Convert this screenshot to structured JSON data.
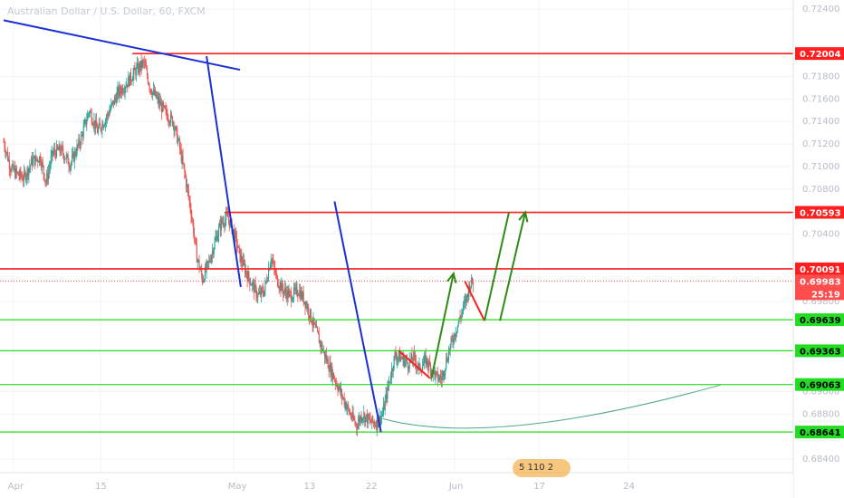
{
  "chart_data": {
    "type": "candlestick",
    "title": "Australian Dollar / U.S. Dollar, 60, FXCM",
    "ylim": [
      0.6828,
      0.7248
    ],
    "y_ticks": [
      "0.72400",
      "0.71800",
      "0.71600",
      "0.71400",
      "0.71200",
      "0.71000",
      "0.70800",
      "0.70400",
      "0.69800",
      "0.69000",
      "0.68800",
      "0.68400"
    ],
    "x_ticks": [
      {
        "label": "Apr",
        "bar": -28
      },
      {
        "label": "15",
        "bar": 79
      },
      {
        "label": "May",
        "bar": 242
      },
      {
        "label": "13",
        "bar": 335
      },
      {
        "label": "22",
        "bar": 411
      },
      {
        "label": "Jun",
        "bar": 513
      },
      {
        "label": "17",
        "bar": 617
      },
      {
        "label": "24",
        "bar": 727
      }
    ],
    "candles_keypoints": [
      [
        -40,
        0.7122
      ],
      [
        -32,
        0.71
      ],
      [
        -25,
        0.7094
      ],
      [
        -15,
        0.709
      ],
      [
        -5,
        0.7105
      ],
      [
        5,
        0.7108
      ],
      [
        12,
        0.7086
      ],
      [
        20,
        0.7112
      ],
      [
        30,
        0.7115
      ],
      [
        42,
        0.7102
      ],
      [
        55,
        0.7125
      ],
      [
        65,
        0.715
      ],
      [
        75,
        0.7132
      ],
      [
        85,
        0.7142
      ],
      [
        100,
        0.7165
      ],
      [
        112,
        0.7175
      ],
      [
        122,
        0.7185
      ],
      [
        132,
        0.7192
      ],
      [
        140,
        0.717
      ],
      [
        148,
        0.716
      ],
      [
        158,
        0.7148
      ],
      [
        168,
        0.714
      ],
      [
        175,
        0.712
      ],
      [
        183,
        0.709
      ],
      [
        190,
        0.706
      ],
      [
        197,
        0.702
      ],
      [
        204,
        0.7
      ],
      [
        212,
        0.7015
      ],
      [
        220,
        0.7035
      ],
      [
        227,
        0.705
      ],
      [
        235,
        0.7055
      ],
      [
        243,
        0.704
      ],
      [
        250,
        0.702
      ],
      [
        258,
        0.7005
      ],
      [
        265,
        0.6995
      ],
      [
        272,
        0.6985
      ],
      [
        280,
        0.699
      ],
      [
        288,
        0.702
      ],
      [
        295,
        0.7
      ],
      [
        303,
        0.699
      ],
      [
        312,
        0.6985
      ],
      [
        322,
        0.699
      ],
      [
        330,
        0.698
      ],
      [
        340,
        0.696
      ],
      [
        350,
        0.694
      ],
      [
        358,
        0.6925
      ],
      [
        367,
        0.691
      ],
      [
        376,
        0.6895
      ],
      [
        385,
        0.688
      ],
      [
        393,
        0.687
      ],
      [
        400,
        0.688
      ],
      [
        410,
        0.6873
      ],
      [
        418,
        0.6872
      ],
      [
        425,
        0.688
      ],
      [
        432,
        0.6905
      ],
      [
        440,
        0.6932
      ],
      [
        448,
        0.693
      ],
      [
        456,
        0.6925
      ],
      [
        463,
        0.693
      ],
      [
        470,
        0.692
      ],
      [
        478,
        0.6928
      ],
      [
        485,
        0.692
      ],
      [
        492,
        0.6912
      ],
      [
        498,
        0.6912
      ],
      [
        502,
        0.6925
      ],
      [
        508,
        0.694
      ],
      [
        515,
        0.6955
      ],
      [
        522,
        0.697
      ],
      [
        528,
        0.6983
      ],
      [
        532,
        0.6995
      ],
      [
        536,
        0.6998
      ]
    ],
    "horizontal_levels": [
      {
        "value": 0.72004,
        "label": "0.72004",
        "color": "#ff1f1f"
      },
      {
        "value": 0.70593,
        "label": "0.70593",
        "color": "#ff1f1f"
      },
      {
        "value": 0.70091,
        "label": "0.70091",
        "color": "#ff1f1f"
      },
      {
        "value": 0.69639,
        "label": "0.69639",
        "color": "#22dd22"
      },
      {
        "value": 0.69363,
        "label": "0.69363",
        "color": "#22dd22"
      },
      {
        "value": 0.69063,
        "label": "0.69063",
        "color": "#22dd22"
      },
      {
        "value": 0.68641,
        "label": "0.68641",
        "color": "#22dd22"
      }
    ],
    "current_price": {
      "value": 0.69983,
      "label": "0.69983",
      "color": "#ff4d4d"
    },
    "countdown": "25:19",
    "blue_lines": [
      {
        "from": [
          -40,
          0.723
        ],
        "to": [
          250,
          0.7186
        ]
      },
      {
        "from": [
          209,
          0.7198
        ],
        "to": [
          251,
          0.6993
        ]
      },
      {
        "from": [
          366,
          0.7069
        ],
        "to": [
          423,
          0.68641
        ]
      }
    ],
    "red_zigzags": [
      [
        [
          445,
          0.69363
        ],
        [
          483,
          0.6912
        ]
      ],
      [
        [
          526,
          0.6998
        ],
        [
          550,
          0.6963
        ],
        [
          580,
          0.70593
        ]
      ]
    ],
    "green_arrows": [
      {
        "from": [
          485,
          0.6912
        ],
        "to": [
          512,
          0.7005
        ]
      },
      {
        "from": [
          569,
          0.6963
        ],
        "to": [
          600,
          0.70593
        ]
      }
    ],
    "curve": {
      "from": [
        425,
        0.6876
      ],
      "mid": [
        560,
        0.6864
      ],
      "to": [
        840,
        0.6906
      ],
      "color": "#4da68a"
    },
    "colors": {
      "up": "#26a69a",
      "down": "#ef5350",
      "grid": "#f0f3f8",
      "axis_text": "#b7bcc6"
    }
  },
  "watermark": {
    "counts": "5  110  2"
  }
}
